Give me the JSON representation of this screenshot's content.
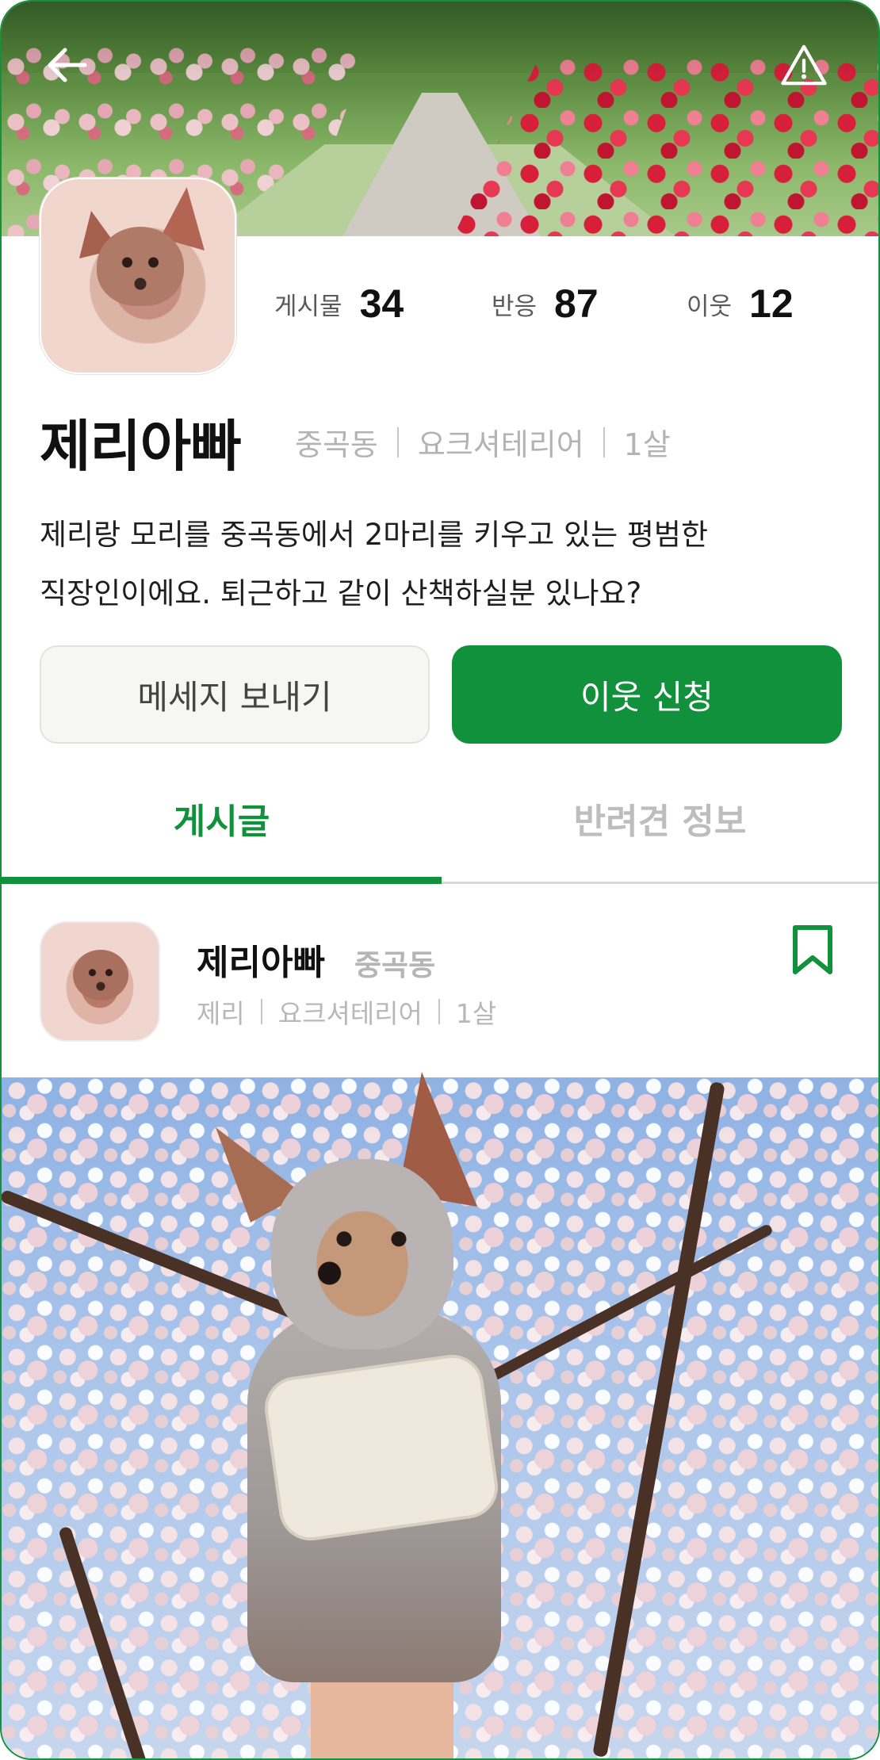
{
  "header": {
    "back_icon": "arrow-left-icon",
    "report_icon": "warning-triangle-icon"
  },
  "profile": {
    "stats": [
      {
        "label": "게시물",
        "value": "34"
      },
      {
        "label": "반응",
        "value": "87"
      },
      {
        "label": "이웃",
        "value": "12"
      }
    ],
    "name": "제리아빠",
    "meta": [
      "중곡동",
      "요크셔테리어",
      "1살"
    ],
    "bio_lines": [
      "제리랑 모리를 중곡동에서 2마리를 키우고 있는 평범한",
      "직장인이에요. 퇴근하고 같이 산책하실분 있나요?"
    ]
  },
  "actions": {
    "message": "메세지 보내기",
    "neighbor_request": "이웃 신청"
  },
  "tabs": [
    {
      "label": "게시글",
      "active": true
    },
    {
      "label": "반려견 정보",
      "active": false
    }
  ],
  "post": {
    "author": "제리아빠",
    "town": "중곡동",
    "meta": [
      "제리",
      "요크셔테리어",
      "1살"
    ],
    "bookmark_icon": "bookmark-icon"
  },
  "colors": {
    "accent": "#12913c",
    "muted": "#b3b3b3"
  }
}
